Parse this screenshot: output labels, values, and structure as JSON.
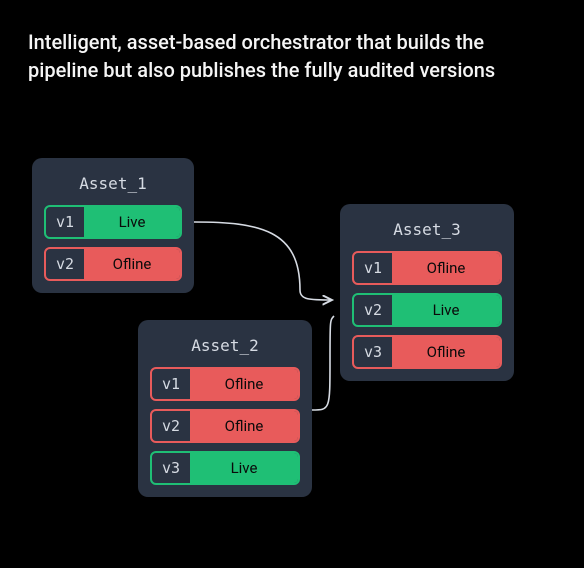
{
  "heading": "Intelligent, asset-based orchestrator that builds the pipeline but also publishes the fully audited versions",
  "status_labels": {
    "live": "Live",
    "offline": "Ofline"
  },
  "colors": {
    "live": "#1fbf75",
    "offline": "#e85b5b",
    "card_bg": "#2a3342",
    "page_bg": "#000000"
  },
  "assets": [
    {
      "id": "asset-1",
      "title": "Asset_1",
      "versions": [
        {
          "tag": "v1",
          "status": "live"
        },
        {
          "tag": "v2",
          "status": "offline"
        }
      ]
    },
    {
      "id": "asset-2",
      "title": "Asset_2",
      "versions": [
        {
          "tag": "v1",
          "status": "offline"
        },
        {
          "tag": "v2",
          "status": "offline"
        },
        {
          "tag": "v3",
          "status": "live"
        }
      ]
    },
    {
      "id": "asset-3",
      "title": "Asset_3",
      "versions": [
        {
          "tag": "v1",
          "status": "offline"
        },
        {
          "tag": "v2",
          "status": "live"
        },
        {
          "tag": "v3",
          "status": "offline"
        }
      ]
    }
  ],
  "edges": [
    {
      "from": "asset-1",
      "to": "asset-3"
    },
    {
      "from": "asset-2",
      "to": "asset-3"
    }
  ]
}
